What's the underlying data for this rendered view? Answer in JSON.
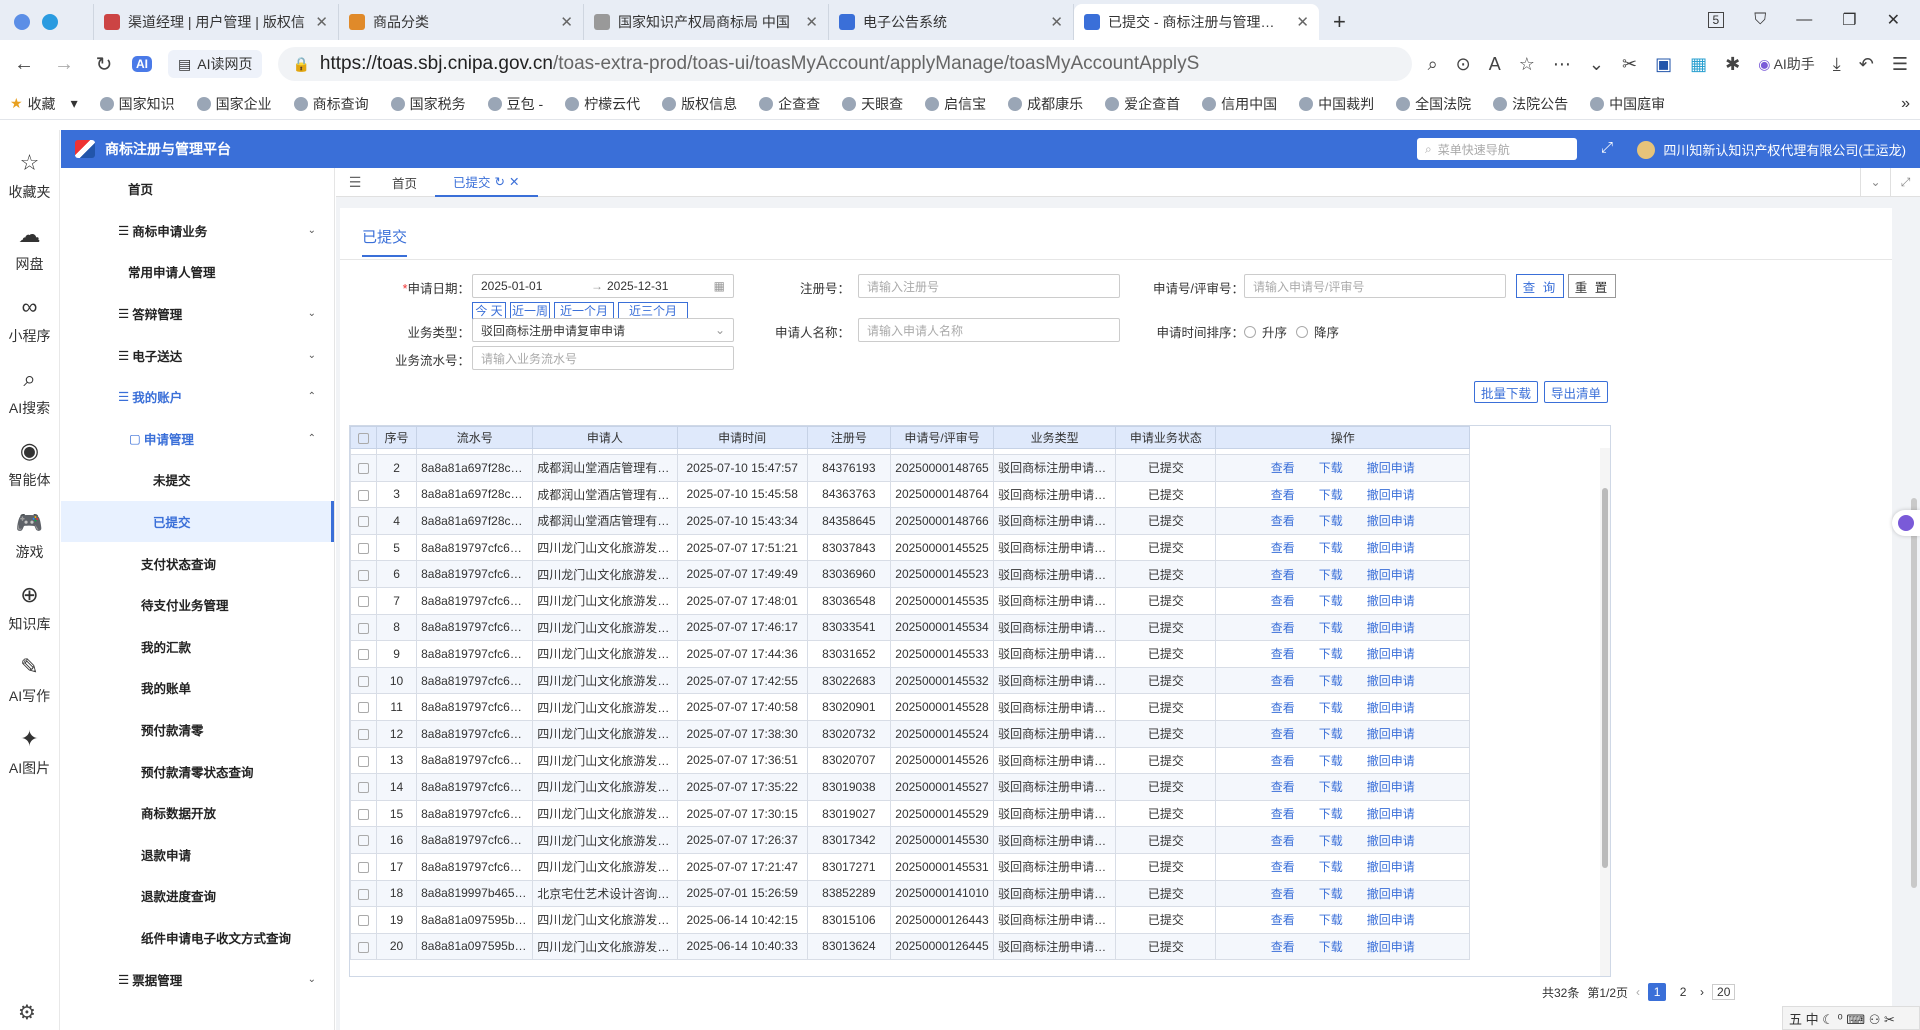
{
  "browser": {
    "tabs": [
      {
        "title": "渠道经理 | 用户管理 | 版权信",
        "color": "#c44"
      },
      {
        "title": "商品分类",
        "color": "#e08a2a"
      },
      {
        "title": "国家知识产权局商标局 中国",
        "color": "#999"
      },
      {
        "title": "电子公告系统",
        "color": "#3a6fd8"
      },
      {
        "title": "已提交 - 商标注册与管理平台",
        "color": "#3a6fd8",
        "active": true
      }
    ],
    "new_tab": "+",
    "tab_count": "5",
    "ai_read": "AI读网页",
    "url_host": "https://toas.sbj.cnipa.gov.cn",
    "url_path": "/toas-extra-prod/toas-ui/toasMyAccount/applyManage/toasMyAccountApplyS",
    "ai_assistant": "AI助手",
    "bookmarks": [
      "收藏",
      "国家知识",
      "国家企业",
      "商标查询",
      "国家税务",
      "豆包 -",
      "柠檬云代",
      "版权信息",
      "企查查",
      "天眼查",
      "启信宝",
      "成都康乐",
      "爱企查首",
      "信用中国",
      "中国裁判",
      "全国法院",
      "法院公告",
      "中国庭审"
    ],
    "side_items": [
      {
        "label": "收藏夹",
        "icon": "star-icon",
        "glyph": "☆"
      },
      {
        "label": "网盘",
        "icon": "cloud-icon",
        "glyph": "☁"
      },
      {
        "label": "小程序",
        "icon": "link-icon",
        "glyph": "∞"
      },
      {
        "label": "AI搜索",
        "icon": "search-icon",
        "glyph": "⌕"
      },
      {
        "label": "智能体",
        "icon": "bot-icon",
        "glyph": "◉"
      },
      {
        "label": "游戏",
        "icon": "gamepad-icon",
        "glyph": "🎮"
      },
      {
        "label": "知识库",
        "icon": "knowledge-icon",
        "glyph": "⊕"
      },
      {
        "label": "AI写作",
        "icon": "pen-icon",
        "glyph": "✎"
      },
      {
        "label": "AI图片",
        "icon": "image-icon",
        "glyph": "✦"
      }
    ]
  },
  "app": {
    "title": "商标注册与管理平台",
    "menu_search_placeholder": "菜单快速导航",
    "company": "四川知新认知识产权代理有限公司(王运龙)",
    "menu": [
      {
        "label": "首页",
        "level": 0
      },
      {
        "label": "商标申请业务",
        "level": 0,
        "prefix": "☰",
        "arrow": "⌄"
      },
      {
        "label": "常用申请人管理",
        "level": 0
      },
      {
        "label": "答辩管理",
        "level": 0,
        "prefix": "☰",
        "arrow": "⌄"
      },
      {
        "label": "电子送达",
        "level": 0,
        "prefix": "☰",
        "arrow": "⌄"
      },
      {
        "label": "我的账户",
        "level": 0,
        "prefix": "☰",
        "arrow": "⌃",
        "open": true
      },
      {
        "label": "申请管理",
        "level": 1,
        "prefix": "▢",
        "arrow": "⌃",
        "open": true
      },
      {
        "label": "未提交",
        "level": 2
      },
      {
        "label": "已提交",
        "level": 2,
        "selected": true
      },
      {
        "label": "支付状态查询",
        "level": 3
      },
      {
        "label": "待支付业务管理",
        "level": 3
      },
      {
        "label": "我的汇款",
        "level": 3
      },
      {
        "label": "我的账单",
        "level": 3
      },
      {
        "label": "预付款清零",
        "level": 3
      },
      {
        "label": "预付款清零状态查询",
        "level": 3
      },
      {
        "label": "商标数据开放",
        "level": 3
      },
      {
        "label": "退款申请",
        "level": 3
      },
      {
        "label": "退款进度查询",
        "level": 3
      },
      {
        "label": "纸件申请电子收文方式查询",
        "level": 3
      },
      {
        "label": "票据管理",
        "level": 0,
        "prefix": "☰",
        "arrow": "⌄"
      }
    ],
    "page_tabs": {
      "home": "首页",
      "current": "已提交"
    },
    "panel_title": "已提交",
    "form": {
      "date_label": "申请日期：",
      "date_required": "*",
      "date_start": "2025-01-01",
      "date_arrow": "→",
      "date_end": "2025-12-31",
      "quick": [
        "今 天",
        "近一周",
        "近一个月",
        "近三个月"
      ],
      "reg_label": "注册号：",
      "reg_placeholder": "请输入注册号",
      "appno_label": "申请号/评审号：",
      "appno_placeholder": "请输入申请号/评审号",
      "query": "查 询",
      "reset": "重 置",
      "biz_label": "业务类型：",
      "biz_value": "驳回商标注册申请复审申请",
      "applicant_label": "申请人名称：",
      "applicant_placeholder": "请输入申请人名称",
      "sort_label": "申请时间排序：",
      "sort_asc": "升序",
      "sort_desc": "降序",
      "flow_label": "业务流水号：",
      "flow_placeholder": "请输入业务流水号",
      "batch_download": "批量下载",
      "export": "导出清单"
    },
    "table": {
      "headers": [
        "序号",
        "流水号",
        "申请人",
        "申请时间",
        "注册号",
        "申请号/评审号",
        "业务类型",
        "申请业务状态",
        "操作"
      ],
      "actions": [
        "查看",
        "下载",
        "撤回申请"
      ],
      "rows": [
        [
          "2",
          "8a8a81a697f28cb7…",
          "成都润山堂酒店管理有限…",
          "2025-07-10 15:47:57",
          "84376193",
          "20250000148765",
          "驳回商标注册申请复审申请",
          "已提交"
        ],
        [
          "3",
          "8a8a81a697f28cb7…",
          "成都润山堂酒店管理有限…",
          "2025-07-10 15:45:58",
          "84363763",
          "20250000148764",
          "驳回商标注册申请复审申请",
          "已提交"
        ],
        [
          "4",
          "8a8a81a697f28cb7…",
          "成都润山堂酒店管理有限…",
          "2025-07-10 15:43:34",
          "84358645",
          "20250000148766",
          "驳回商标注册申请复审申请",
          "已提交"
        ],
        [
          "5",
          "8a8a819797cfc671…",
          "四川龙门山文化旅游发展…",
          "2025-07-07 17:51:21",
          "83037843",
          "20250000145525",
          "驳回商标注册申请复审申请",
          "已提交"
        ],
        [
          "6",
          "8a8a819797cfc671…",
          "四川龙门山文化旅游发展…",
          "2025-07-07 17:49:49",
          "83036960",
          "20250000145523",
          "驳回商标注册申请复审申请",
          "已提交"
        ],
        [
          "7",
          "8a8a819797cfc671…",
          "四川龙门山文化旅游发展…",
          "2025-07-07 17:48:01",
          "83036548",
          "20250000145535",
          "驳回商标注册申请复审申请",
          "已提交"
        ],
        [
          "8",
          "8a8a819797cfc671…",
          "四川龙门山文化旅游发展…",
          "2025-07-07 17:46:17",
          "83033541",
          "20250000145534",
          "驳回商标注册申请复审申请",
          "已提交"
        ],
        [
          "9",
          "8a8a819797cfc671…",
          "四川龙门山文化旅游发展…",
          "2025-07-07 17:44:36",
          "83031652",
          "20250000145533",
          "驳回商标注册申请复审申请",
          "已提交"
        ],
        [
          "10",
          "8a8a819797cfc671…",
          "四川龙门山文化旅游发展…",
          "2025-07-07 17:42:55",
          "83022683",
          "20250000145532",
          "驳回商标注册申请复审申请",
          "已提交"
        ],
        [
          "11",
          "8a8a819797cfc671…",
          "四川龙门山文化旅游发展…",
          "2025-07-07 17:40:58",
          "83020901",
          "20250000145528",
          "驳回商标注册申请复审申请",
          "已提交"
        ],
        [
          "12",
          "8a8a819797cfc671…",
          "四川龙门山文化旅游发展…",
          "2025-07-07 17:38:30",
          "83020732",
          "20250000145524",
          "驳回商标注册申请复审申请",
          "已提交"
        ],
        [
          "13",
          "8a8a819797cfc671…",
          "四川龙门山文化旅游发展…",
          "2025-07-07 17:36:51",
          "83020707",
          "20250000145526",
          "驳回商标注册申请复审申请",
          "已提交"
        ],
        [
          "14",
          "8a8a819797cfc671…",
          "四川龙门山文化旅游发展…",
          "2025-07-07 17:35:22",
          "83019038",
          "20250000145527",
          "驳回商标注册申请复审申请",
          "已提交"
        ],
        [
          "15",
          "8a8a819797cfc671…",
          "四川龙门山文化旅游发展…",
          "2025-07-07 17:30:15",
          "83019027",
          "20250000145529",
          "驳回商标注册申请复审申请",
          "已提交"
        ],
        [
          "16",
          "8a8a819797cfc671…",
          "四川龙门山文化旅游发展…",
          "2025-07-07 17:26:37",
          "83017342",
          "20250000145530",
          "驳回商标注册申请复审申请",
          "已提交"
        ],
        [
          "17",
          "8a8a819797cfc671…",
          "四川龙门山文化旅游发展…",
          "2025-07-07 17:21:47",
          "83017271",
          "20250000145531",
          "驳回商标注册申请复审申请",
          "已提交"
        ],
        [
          "18",
          "8a8a819997b465f2…",
          "北京宅仕艺术设计咨询有…",
          "2025-07-01 15:26:59",
          "83852289",
          "20250000141010",
          "驳回商标注册申请复审申请",
          "已提交"
        ],
        [
          "19",
          "8a8a81a097595b76…",
          "四川龙门山文化旅游发展…",
          "2025-06-14 10:42:15",
          "83015106",
          "20250000126443",
          "驳回商标注册申请复审申请",
          "已提交"
        ],
        [
          "20",
          "8a8a81a097595b76…",
          "四川龙门山文化旅游发展…",
          "2025-06-14 10:40:33",
          "83013624",
          "20250000126445",
          "驳回商标注册申请复审申请",
          "已提交"
        ]
      ]
    },
    "pager": {
      "total": "共32条",
      "page": "第1/2页",
      "prev": "‹",
      "p1": "1",
      "p2": "2",
      "next": "›",
      "size": "20"
    },
    "ime": "五 中 ☾ ⁰ ⌨ ⚇ ✂"
  }
}
